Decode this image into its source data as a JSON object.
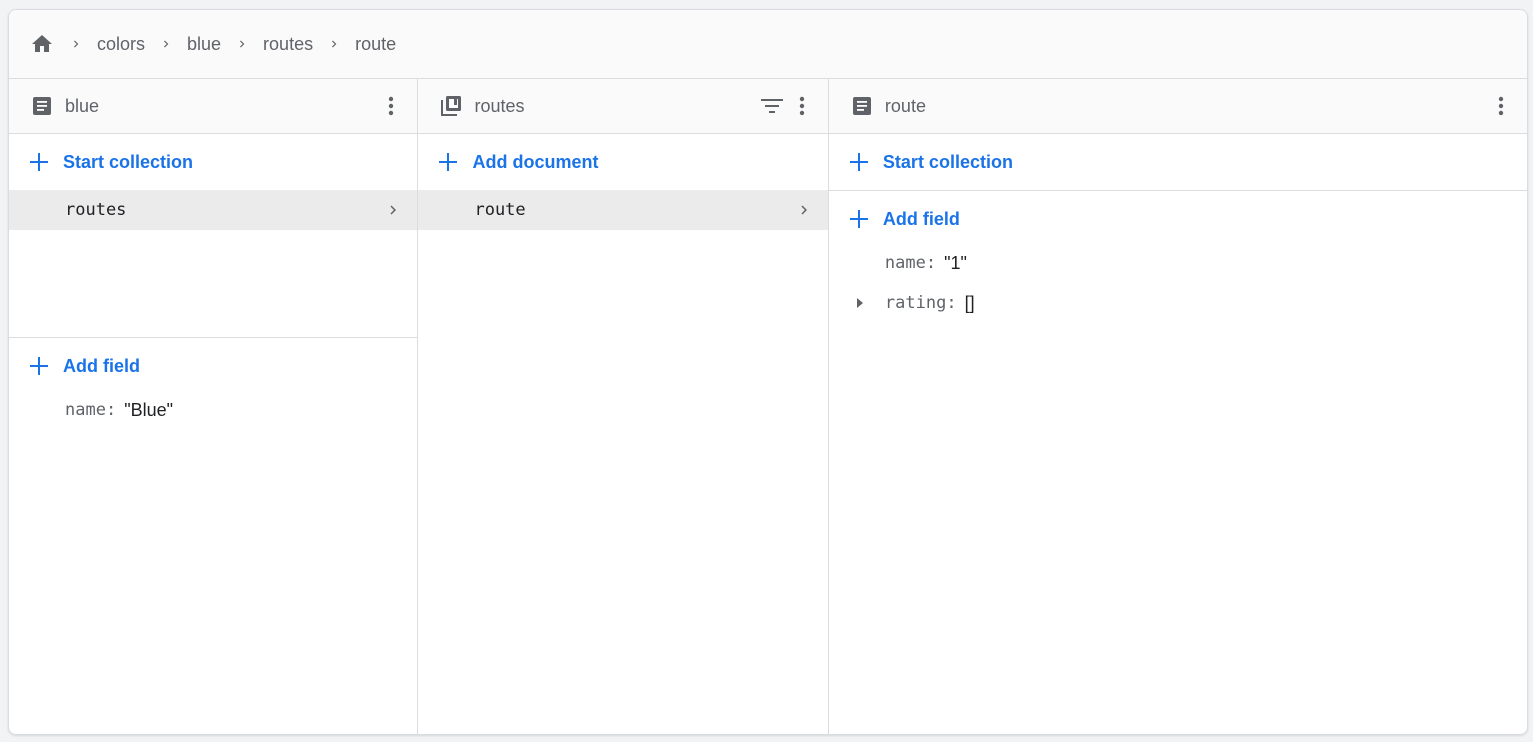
{
  "breadcrumb": {
    "items": [
      "colors",
      "blue",
      "routes",
      "route"
    ]
  },
  "columns": [
    {
      "title": "blue",
      "icon": "document-icon",
      "start_collection_label": "Start collection",
      "collections": [
        {
          "name": "routes"
        }
      ],
      "add_field_label": "Add field",
      "fields": [
        {
          "key": "name",
          "value": "\"Blue\""
        }
      ]
    },
    {
      "title": "routes",
      "icon": "collection-icon",
      "add_document_label": "Add document",
      "documents": [
        {
          "name": "route"
        }
      ]
    },
    {
      "title": "route",
      "icon": "document-icon",
      "start_collection_label": "Start collection",
      "add_field_label": "Add field",
      "fields": [
        {
          "key": "name",
          "value": "\"1\""
        },
        {
          "key": "rating",
          "value": "[]"
        }
      ]
    }
  ],
  "colors": {
    "accent": "#1a73e8",
    "icon": "#5f6368",
    "selected_row": "#ebebeb",
    "border": "#dadce0"
  }
}
